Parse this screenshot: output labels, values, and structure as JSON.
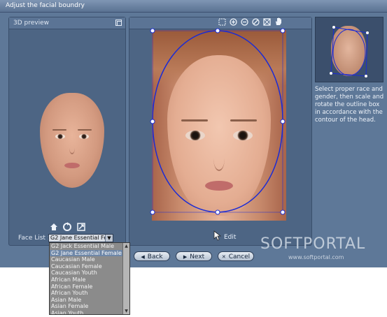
{
  "window": {
    "title": "Adjust the facial boundry"
  },
  "preview_panel": {
    "title": "3D preview"
  },
  "preview_tools": [
    "home-icon",
    "rotate-icon",
    "fit-icon"
  ],
  "canvas_toolbar": [
    "select-icon",
    "zoom-in-icon",
    "zoom-out-icon",
    "rotate-icon",
    "fit-icon",
    "hand-icon"
  ],
  "edit": {
    "label": "Edit"
  },
  "face_list": {
    "label": "Face List :",
    "selected": "G2 Jane Essential Fei",
    "options": [
      "G2 Jack Essential Male",
      "G2 Jane Essential Female",
      "Caucasian Male",
      "Caucasian Female",
      "Caucasian Youth",
      "African Male",
      "African Female",
      "African Youth",
      "Asian Male",
      "Asian Female",
      "Asian Youth"
    ],
    "highlighted_index": 1
  },
  "buttons": {
    "back": "Back",
    "next": "Next",
    "cancel": "Cancel"
  },
  "instructions": "Select proper race and gender, then scale and rotate the outline box in accordance with the contour of the head.",
  "watermark": {
    "text": "SOFTPORTAL",
    "url": "www.softportal.com"
  },
  "colors": {
    "window_bg": "#5e7898",
    "panel_bg": "#4d6584",
    "outline": "#1a2bd6",
    "dropdown_bg": "#8b8b8b"
  }
}
